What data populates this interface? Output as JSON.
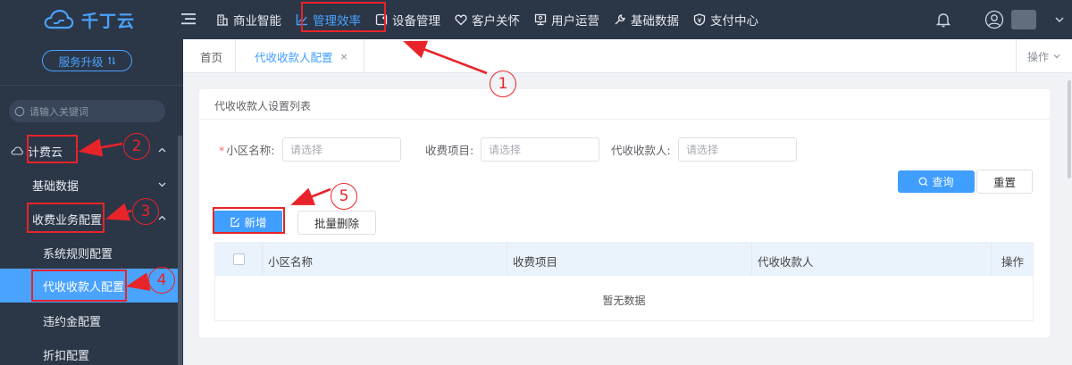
{
  "app": {
    "logo_text": "千丁云"
  },
  "topnav": {
    "items": [
      {
        "label": "商业智能",
        "icon": "building-icon",
        "active": false
      },
      {
        "label": "管理效率",
        "icon": "chart-line-icon",
        "active": true
      },
      {
        "label": "设备管理",
        "icon": "device-icon",
        "active": false
      },
      {
        "label": "客户关怀",
        "icon": "heart-icon",
        "active": false
      },
      {
        "label": "用户运营",
        "icon": "user-ops-icon",
        "active": false
      },
      {
        "label": "基础数据",
        "icon": "wrench-icon",
        "active": false
      },
      {
        "label": "支付中心",
        "icon": "shield-pay-icon",
        "active": false
      }
    ]
  },
  "sidebar": {
    "upgrade_label": "服务升级",
    "search_placeholder": "请输入关键词",
    "items": [
      {
        "label": "计费云",
        "level": 1,
        "expanded": true
      },
      {
        "label": "基础数据",
        "level": 2,
        "expanded": false
      },
      {
        "label": "收费业务配置",
        "level": 2,
        "expanded": true
      },
      {
        "label": "系统规则配置",
        "level": 3
      },
      {
        "label": "代收收款人配置",
        "level": 3,
        "selected": true
      },
      {
        "label": "违约金配置",
        "level": 3
      },
      {
        "label": "折扣配置",
        "level": 3
      }
    ]
  },
  "tabs": {
    "items": [
      {
        "label": "首页",
        "closable": false
      },
      {
        "label": "代收收款人配置",
        "closable": true,
        "active": true
      }
    ],
    "close_glyph": "×",
    "ops_label": "操作"
  },
  "card": {
    "title": "代收收款人设置列表",
    "filters": [
      {
        "label": "小区名称:",
        "required": true,
        "placeholder": "请选择"
      },
      {
        "label": "收费项目:",
        "required": false,
        "placeholder": "请选择"
      },
      {
        "label": "代收收款人:",
        "required": false,
        "placeholder": "请选择"
      }
    ],
    "query_label": "查询",
    "reset_label": "重置",
    "add_label": "新增",
    "batch_delete_label": "批量删除",
    "table": {
      "columns": [
        "小区名称",
        "收费项目",
        "代收收款人",
        "操作"
      ],
      "rows": [],
      "empty_text": "暂无数据"
    }
  },
  "annotations": {
    "numbers": [
      "1",
      "2",
      "3",
      "4",
      "5"
    ],
    "color": "#e8242a"
  },
  "colors": {
    "primary": "#409eff",
    "nav_bg": "#2b3647",
    "annotation": "#e8242a"
  }
}
